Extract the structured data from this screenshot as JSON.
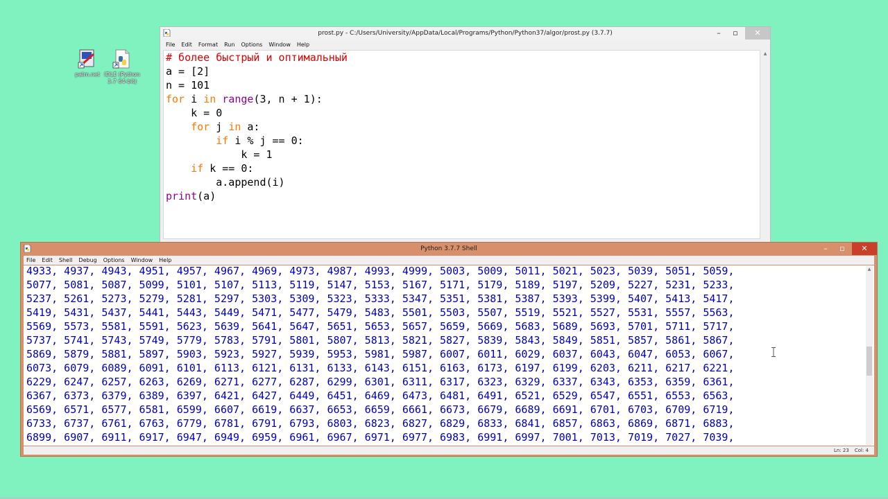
{
  "desktop": {
    "icons": [
      {
        "label": "palm.net",
        "icon": "palm-shortcut-icon"
      },
      {
        "label": "IDLE (Python 3.7 64-bit)",
        "icon": "python-idle-icon"
      }
    ]
  },
  "editor": {
    "title": "prost.py - C:/Users/University/AppData/Local/Programs/Python/Python37/algor/prost.py (3.7.7)",
    "menu": [
      "File",
      "Edit",
      "Format",
      "Run",
      "Options",
      "Window",
      "Help"
    ],
    "code": [
      [
        {
          "t": "# более быстрый и оптимальный",
          "c": "cm"
        }
      ],
      [
        {
          "t": "a = [2]",
          "c": ""
        }
      ],
      [
        {
          "t": "n = 101",
          "c": ""
        }
      ],
      [
        {
          "t": "for",
          "c": "kw"
        },
        {
          "t": " i ",
          "c": ""
        },
        {
          "t": "in",
          "c": "kw"
        },
        {
          "t": " ",
          "c": ""
        },
        {
          "t": "range",
          "c": "bi"
        },
        {
          "t": "(3, n + 1):",
          "c": ""
        }
      ],
      [
        {
          "t": "    k = 0",
          "c": ""
        }
      ],
      [
        {
          "t": "    ",
          "c": ""
        },
        {
          "t": "for",
          "c": "kw"
        },
        {
          "t": " j ",
          "c": ""
        },
        {
          "t": "in",
          "c": "kw"
        },
        {
          "t": " a:",
          "c": ""
        }
      ],
      [
        {
          "t": "        ",
          "c": ""
        },
        {
          "t": "if",
          "c": "kw"
        },
        {
          "t": " i % j == 0:",
          "c": ""
        }
      ],
      [
        {
          "t": "            k = 1",
          "c": ""
        }
      ],
      [
        {
          "t": "    ",
          "c": ""
        },
        {
          "t": "if",
          "c": "kw"
        },
        {
          "t": " k == 0:",
          "c": ""
        }
      ],
      [
        {
          "t": "        a.append(i)",
          "c": ""
        }
      ],
      [
        {
          "t": "print",
          "c": "bi"
        },
        {
          "t": "(a)",
          "c": ""
        }
      ]
    ]
  },
  "shell": {
    "title": "Python 3.7.7 Shell",
    "menu": [
      "File",
      "Edit",
      "Shell",
      "Debug",
      "Options",
      "Window",
      "Help"
    ],
    "output": [
      "4933, 4937, 4943, 4951, 4957, 4967, 4969, 4973, 4987, 4993, 4999, 5003, 5009, 5011, 5021, 5023, 5039, 5051, 5059,",
      "5077, 5081, 5087, 5099, 5101, 5107, 5113, 5119, 5147, 5153, 5167, 5171, 5179, 5189, 5197, 5209, 5227, 5231, 5233,",
      "5237, 5261, 5273, 5279, 5281, 5297, 5303, 5309, 5323, 5333, 5347, 5351, 5381, 5387, 5393, 5399, 5407, 5413, 5417,",
      "5419, 5431, 5437, 5441, 5443, 5449, 5471, 5477, 5479, 5483, 5501, 5503, 5507, 5519, 5521, 5527, 5531, 5557, 5563,",
      "5569, 5573, 5581, 5591, 5623, 5639, 5641, 5647, 5651, 5653, 5657, 5659, 5669, 5683, 5689, 5693, 5701, 5711, 5717,",
      "5737, 5741, 5743, 5749, 5779, 5783, 5791, 5801, 5807, 5813, 5821, 5827, 5839, 5843, 5849, 5851, 5857, 5861, 5867,",
      "5869, 5879, 5881, 5897, 5903, 5923, 5927, 5939, 5953, 5981, 5987, 6007, 6011, 6029, 6037, 6043, 6047, 6053, 6067,",
      "6073, 6079, 6089, 6091, 6101, 6113, 6121, 6131, 6133, 6143, 6151, 6163, 6173, 6197, 6199, 6203, 6211, 6217, 6221,",
      "6229, 6247, 6257, 6263, 6269, 6271, 6277, 6287, 6299, 6301, 6311, 6317, 6323, 6329, 6337, 6343, 6353, 6359, 6361,",
      "6367, 6373, 6379, 6389, 6397, 6421, 6427, 6449, 6451, 6469, 6473, 6481, 6491, 6521, 6529, 6547, 6551, 6553, 6563,",
      "6569, 6571, 6577, 6581, 6599, 6607, 6619, 6637, 6653, 6659, 6661, 6673, 6679, 6689, 6691, 6701, 6703, 6709, 6719,",
      "6733, 6737, 6761, 6763, 6779, 6781, 6791, 6793, 6803, 6823, 6827, 6829, 6833, 6841, 6857, 6863, 6869, 6871, 6883,",
      "6899, 6907, 6911, 6917, 6947, 6949, 6959, 6961, 6967, 6971, 6977, 6983, 6991, 6997, 7001, 7013, 7019, 7027, 7039,"
    ],
    "status": {
      "line": "Ln: 23",
      "col": "Col: 4"
    }
  },
  "colors": {
    "desktop": "#80f2c0",
    "keyword": "#ff7700",
    "builtin": "#900090",
    "comment": "#dd0000",
    "output": "#0000bb",
    "shell_frame": "#d8906c"
  }
}
